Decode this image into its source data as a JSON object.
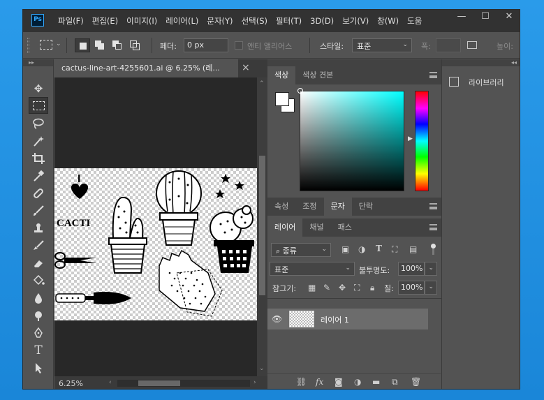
{
  "app": {
    "logo": "Ps",
    "menu": [
      "파일(F)",
      "편집(E)",
      "이미지(I)",
      "레이어(L)",
      "문자(Y)",
      "선택(S)",
      "필터(T)",
      "3D(D)",
      "보기(V)",
      "창(W)",
      "도움"
    ],
    "window_controls": {
      "minimize": "—",
      "maximize": "☐",
      "close": "✕"
    }
  },
  "options": {
    "feather_label": "페더:",
    "feather_value": "0 px",
    "antialias_label": "앤티 앨리어스",
    "style_label": "스타일:",
    "style_value": "표준",
    "width_label": "폭:",
    "height_label": "높이:"
  },
  "toolbar": {
    "collapse": "▸▸",
    "tools": [
      "move-tool",
      "marquee-tool",
      "lasso-tool",
      "magic-wand-tool",
      "crop-tool",
      "eyedropper-tool",
      "healing-brush-tool",
      "brush-tool",
      "clone-stamp-tool",
      "history-brush-tool",
      "eraser-tool",
      "paint-bucket-tool",
      "blur-tool",
      "dodge-tool",
      "pen-tool",
      "type-tool",
      "path-selection-tool"
    ]
  },
  "document": {
    "tab_title": "cactus-line-art-4255601.ai @ 6.25% (레...",
    "tab_close": "×",
    "zoom": "6.25%",
    "art_text_top": "I",
    "art_text_bottom": "CACTI"
  },
  "color_panel": {
    "tabs": [
      "색상",
      "색상 견본"
    ],
    "active_tab": "색상",
    "foreground": "#ffffff",
    "background": "#ffffff"
  },
  "properties_panel": {
    "tabs": [
      "속성",
      "조정",
      "문자",
      "단락"
    ],
    "active_tab": "문자"
  },
  "layers_panel": {
    "tabs": [
      "레이어",
      "채널",
      "패스"
    ],
    "active_tab": "레이어",
    "filter_label": "종류",
    "blend_mode": "표준",
    "opacity_label": "불투명도:",
    "opacity_value": "100%",
    "lock_label": "잠그기:",
    "fill_label": "칠:",
    "fill_value": "100%",
    "layers": [
      {
        "name": "레이어 1",
        "visible": true
      }
    ]
  },
  "dock": {
    "collapse": "◂◂",
    "libraries_label": "라이브러리"
  }
}
